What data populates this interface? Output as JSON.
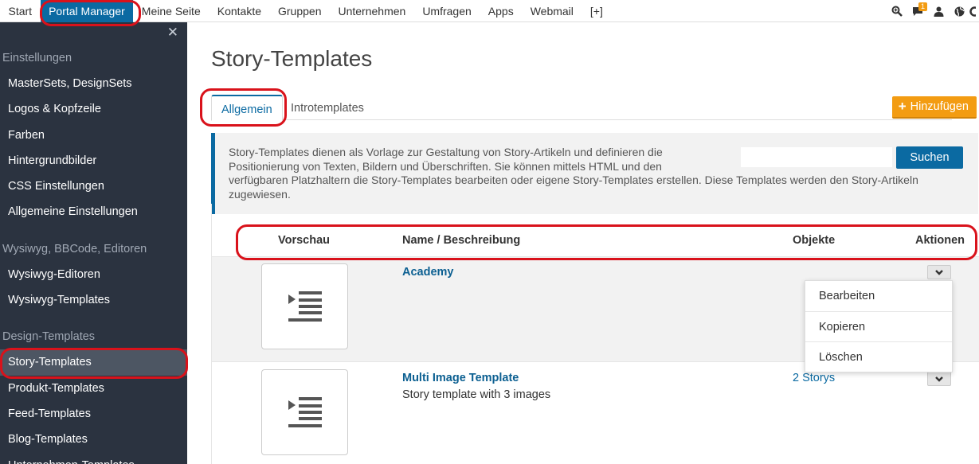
{
  "topnav": {
    "items": [
      "Start",
      "Portal Manager",
      "Meine Seite",
      "Kontakte",
      "Gruppen",
      "Unternehmen",
      "Umfragen",
      "Apps",
      "Webmail",
      "[+]"
    ],
    "active_index": 1,
    "icons": [
      "search-icon",
      "chat-icon",
      "user-icon",
      "globe-icon",
      "gear-icon"
    ],
    "notification_count": "1"
  },
  "sidebar": {
    "sections": [
      {
        "title": "Einstellungen",
        "items": [
          "MasterSets, DesignSets",
          "Logos & Kopfzeile",
          "Farben",
          "Hintergrundbilder",
          "CSS Einstellungen",
          "Allgemeine Einstellungen"
        ]
      },
      {
        "title": "Wysiwyg, BBCode, Editoren",
        "items": [
          "Wysiwyg-Editoren",
          "Wysiwyg-Templates"
        ]
      },
      {
        "title": "Design-Templates",
        "items": [
          "Story-Templates",
          "Produkt-Templates",
          "Feed-Templates",
          "Blog-Templates",
          "Unternehmen-Templates"
        ]
      }
    ],
    "active_item": "Story-Templates"
  },
  "main": {
    "title": "Story-Templates",
    "tabs": [
      {
        "label": "Allgemein",
        "active": true
      },
      {
        "label": "Introtemplates",
        "active": false
      }
    ],
    "add_button": "Hinzufügen",
    "info_text": "Story-Templates dienen als Vorlage zur Gestaltung von Story-Artikeln und definieren die Positionierung von Texten, Bildern und Überschriften. Sie können mittels HTML und den verfügbaren Platzhaltern die Story-Templates bearbeiten oder eigene Story-Templates erstellen. Diese Templates werden den Story-Artikeln zugewiesen.",
    "info_lines": [
      "Story-Templates dienen als Vorlage zur Gestaltung von Story-Artikeln und definieren die",
      "Positionierung von Texten, Bildern und Überschriften. Sie können mittels HTML und den",
      "verfügbaren Platzhaltern die Story-Templates bearbeiten oder eigene Story-Templates erstellen. Diese Templates werden den Story-Artikeln",
      "zugewiesen."
    ],
    "search": {
      "value": "",
      "button": "Suchen"
    },
    "table": {
      "headers": {
        "preview": "Vorschau",
        "name": "Name / Beschreibung",
        "objects": "Objekte",
        "actions": "Aktionen"
      },
      "rows": [
        {
          "name": "Academy",
          "description": "",
          "objects": ""
        },
        {
          "name": "Multi Image Template",
          "description": "Story template with 3 images",
          "objects": "2 Storys"
        }
      ]
    },
    "actions_menu": [
      "Bearbeiten",
      "Kopieren",
      "Löschen"
    ]
  },
  "colors": {
    "accent": "#0b6aa2",
    "sidebar_bg": "#2b3340",
    "add_button": "#f39c12",
    "annotation": "#d9121b"
  }
}
